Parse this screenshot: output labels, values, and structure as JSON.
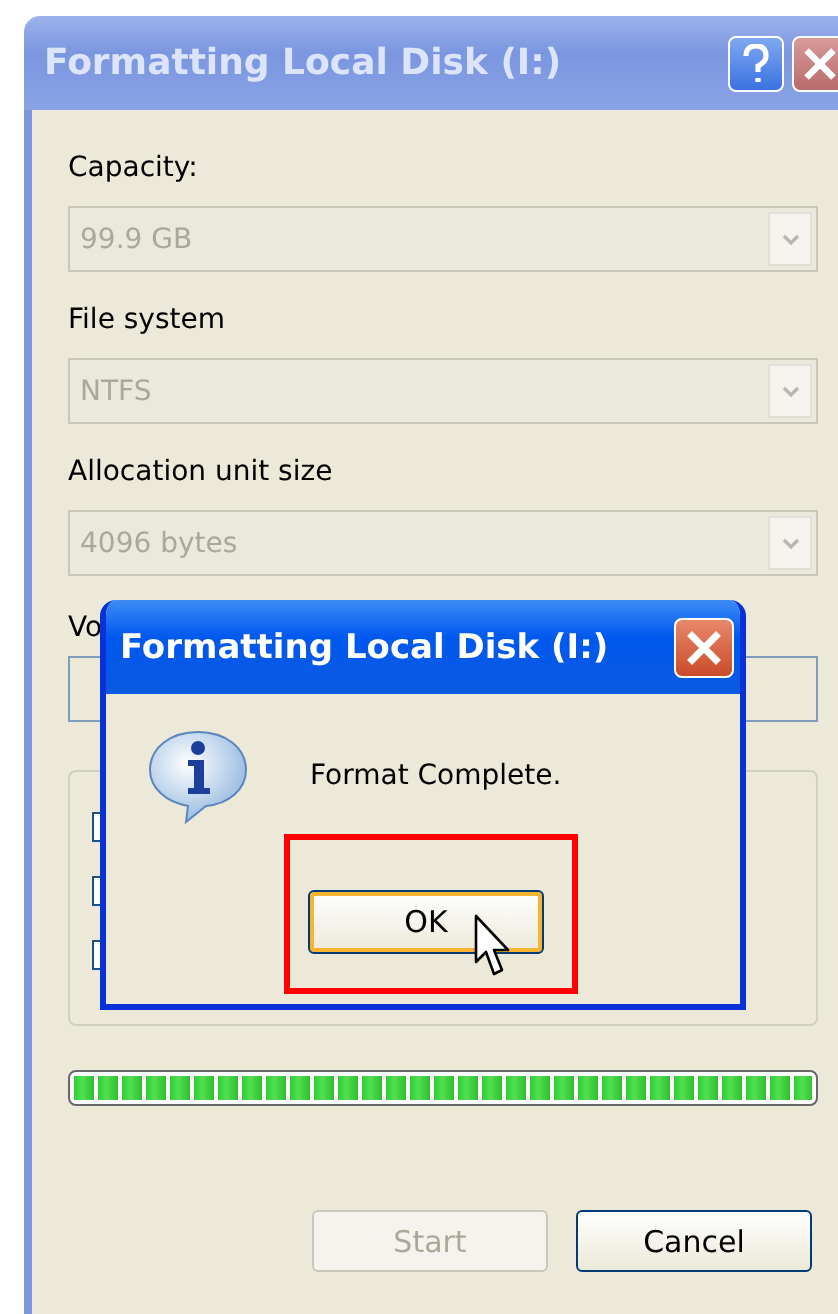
{
  "window": {
    "title": "Formatting Local Disk (I:)",
    "active": false
  },
  "fields": [
    {
      "label": "Capacity:",
      "kind": "combo",
      "value": "99.9 GB",
      "disabled": true
    },
    {
      "label": "File system",
      "kind": "combo",
      "value": "NTFS",
      "disabled": true
    },
    {
      "label": "Allocation unit size",
      "kind": "combo",
      "value": "4096 bytes",
      "disabled": true
    },
    {
      "label": "Vo",
      "kind": "text"
    }
  ],
  "options": [
    {
      "kind": "checkbox"
    },
    {
      "kind": "checkbox"
    },
    {
      "kind": "checkbox"
    }
  ],
  "progress": {
    "level": 1
  },
  "buttons": [
    {
      "label": "Start",
      "disabled": true
    },
    {
      "label": "Cancel",
      "disabled": false
    }
  ],
  "dialog": {
    "title": "Formatting Local Disk (I:)",
    "message": "Format Complete.",
    "button": {
      "label": "OK",
      "highlighted": true,
      "annotated": true
    }
  }
}
